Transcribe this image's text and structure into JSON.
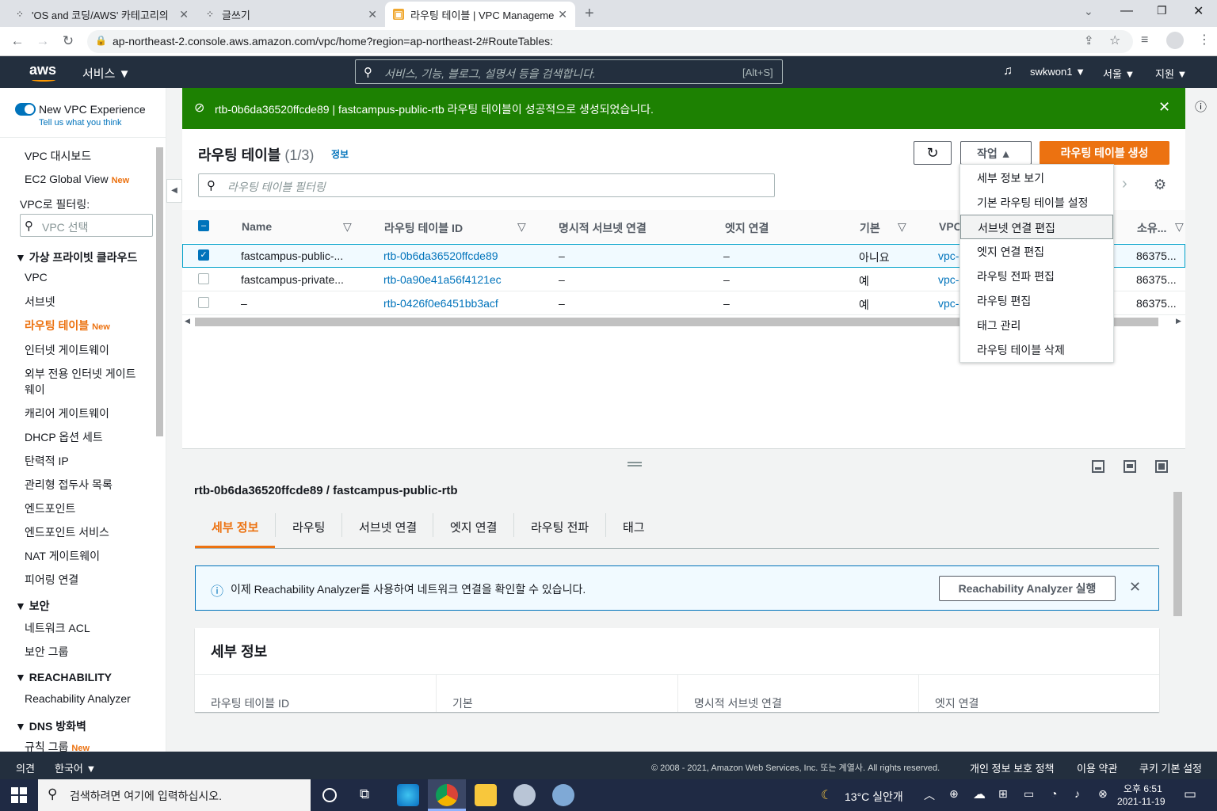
{
  "browser": {
    "tabs": [
      {
        "label": "'OS and 코딩/AWS' 카테고리의",
        "active": false
      },
      {
        "label": "글쓰기",
        "active": false
      },
      {
        "label": "라우팅 테이블 | VPC Manageme",
        "active": true
      }
    ],
    "url": "ap-northeast-2.console.aws.amazon.com/vpc/home?region=ap-northeast-2#RouteTables:"
  },
  "header": {
    "logo": "aws",
    "services": "서비스",
    "search_placeholder": "서비스, 기능, 블로그, 설명서 등을 검색합니다.",
    "search_shortcut": "[Alt+S]",
    "user": "swkwon1",
    "region": "서울",
    "support": "지원"
  },
  "sidebar": {
    "toggle_label": "New VPC Experience",
    "feedback": "Tell us what you think",
    "items": [
      "VPC 대시보드",
      "EC2 Global View"
    ],
    "new_badge": "New",
    "filter_label": "VPC로 필터링:",
    "filter_placeholder": "VPC 선택",
    "section_private": "가상 프라이빗 클라우드",
    "private_items": [
      "VPC",
      "서브넷",
      "라우팅 테이블",
      "인터넷 게이트웨이",
      "외부 전용 인터넷 게이트",
      "웨이",
      "캐리어 게이트웨이",
      "DHCP 옵션 세트",
      "탄력적 IP",
      "관리형 접두사 목록",
      "엔드포인트",
      "엔드포인트 서비스",
      "NAT 게이트웨이",
      "피어링 연결"
    ],
    "section_security": "보안",
    "security_items": [
      "네트워크 ACL",
      "보안 그룹"
    ],
    "section_reach": "REACHABILITY",
    "reach_items": [
      "Reachability Analyzer"
    ],
    "section_dns": "DNS 방화벽",
    "dns_items": [
      "규칙 그룹"
    ]
  },
  "flash": {
    "message": "rtb-0b6da36520ffcde89 | fastcampus-public-rtb 라우팅 테이블이 성공적으로 생성되었습니다."
  },
  "table": {
    "title": "라우팅 테이블",
    "count": "(1/3)",
    "info": "정보",
    "actions": "작업",
    "create": "라우팅 테이블 생성",
    "filter_placeholder": "라우팅 테이블 필터링",
    "columns": [
      "Name",
      "라우팅 테이블 ID",
      "명시적 서브넷 연결",
      "엣지 연결",
      "기본",
      "VPC",
      "소유..."
    ],
    "rows": [
      {
        "name": "fastcampus-public-...",
        "id": "rtb-0b6da36520ffcde89",
        "subnet": "–",
        "edge": "–",
        "main": "아니요",
        "vpc": "vpc-",
        "owner": "86375...",
        "checked": true
      },
      {
        "name": "fastcampus-private...",
        "id": "rtb-0a90e41a56f4121ec",
        "subnet": "–",
        "edge": "–",
        "main": "예",
        "vpc": "vpc-",
        "owner": "86375...",
        "checked": false
      },
      {
        "name": "–",
        "id": "rtb-0426f0e6451bb3acf",
        "subnet": "–",
        "edge": "–",
        "main": "예",
        "vpc": "vpc-",
        "owner": "86375...",
        "checked": false
      }
    ]
  },
  "actions_menu": [
    "세부 정보 보기",
    "기본 라우팅 테이블 설정",
    "서브넷 연결 편집",
    "엣지 연결 편집",
    "라우팅 전파 편집",
    "라우팅 편집",
    "태그 관리",
    "라우팅 테이블 삭제"
  ],
  "detail": {
    "title": "rtb-0b6da36520ffcde89 / fastcampus-public-rtb",
    "tabs": [
      "세부 정보",
      "라우팅",
      "서브넷 연결",
      "엣지 연결",
      "라우팅 전파",
      "태그"
    ],
    "info_text": "이제 Reachability Analyzer를 사용하여 네트워크 연결을 확인할 수 있습니다.",
    "info_button": "Reachability Analyzer 실행",
    "section_title": "세부 정보",
    "fields": [
      "라우팅 테이블 ID",
      "기본",
      "명시적 서브넷 연결",
      "엣지 연결"
    ]
  },
  "footer": {
    "feedback": "의견",
    "language": "한국어",
    "copyright": "© 2008 - 2021, Amazon Web Services, Inc. 또는 계열사. All rights reserved.",
    "privacy": "개인 정보 보호 정책",
    "terms": "이용 약관",
    "cookies": "쿠키 기본 설정"
  },
  "taskbar": {
    "search": "검색하려면 여기에 입력하십시오.",
    "weather": "13°C  실안개",
    "time": "오후 6:51",
    "date": "2021-11-19"
  },
  "colors": {
    "aws_dark": "#232f3e",
    "success": "#1d8102",
    "primary_orange": "#ec7211",
    "link": "#0073bb"
  }
}
